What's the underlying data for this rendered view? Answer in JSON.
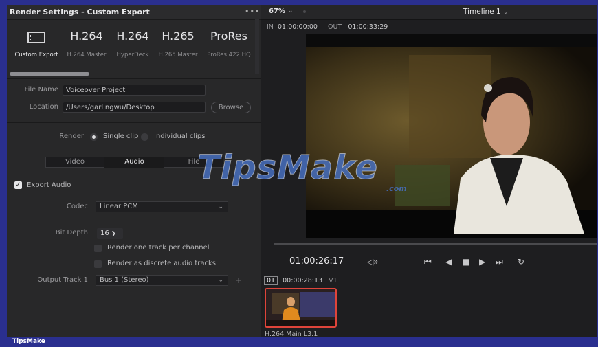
{
  "left_panel": {
    "title": "Render Settings - Custom Export",
    "menu_label": "•••",
    "presets": [
      {
        "big": "",
        "label": "Custom Export",
        "icon": "film-icon",
        "active": true
      },
      {
        "big": "H.264",
        "label": "H.264 Master"
      },
      {
        "big": "H.264",
        "label": "HyperDeck"
      },
      {
        "big": "H.265",
        "label": "H.265 Master"
      },
      {
        "big": "ProRes",
        "label": "ProRes 422 HQ"
      }
    ],
    "file_name_label": "File Name",
    "file_name_value": "Voiceover Project",
    "location_label": "Location",
    "location_value": "/Users/garlingwu/Desktop",
    "browse_label": "Browse",
    "render_label": "Render",
    "render_options": [
      "Single clip",
      "Individual clips"
    ],
    "render_selected": "Single clip",
    "tabs": [
      "Video",
      "Audio",
      "File"
    ],
    "active_tab": "Audio",
    "export_audio_label": "Export Audio",
    "export_audio_checked": true,
    "codec_label": "Codec",
    "codec_value": "Linear PCM",
    "bit_depth_label": "Bit Depth",
    "bit_depth_value": "16",
    "render_one_track_label": "Render one track per channel",
    "render_discrete_label": "Render as discrete audio tracks",
    "output_track_label": "Output Track 1",
    "output_track_value": "Bus 1 (Stereo)"
  },
  "viewer": {
    "zoom": "67%",
    "timeline_name": "Timeline 1",
    "in_label": "IN",
    "in_value": "01:00:00:00",
    "out_label": "OUT",
    "out_value": "01:00:33:29",
    "timecode": "01:00:26:17"
  },
  "clip": {
    "number": "01",
    "timecode": "00:00:28:13",
    "track": "V1",
    "name": "H.264 Main L3.1"
  },
  "watermark": {
    "text": "TipsMake",
    "suffix": ".com"
  },
  "footer": {
    "brand": "TipsMake"
  },
  "colors": {
    "frame": "#2a2f8f",
    "accent_red": "#e0443a",
    "panel": "#282829"
  }
}
